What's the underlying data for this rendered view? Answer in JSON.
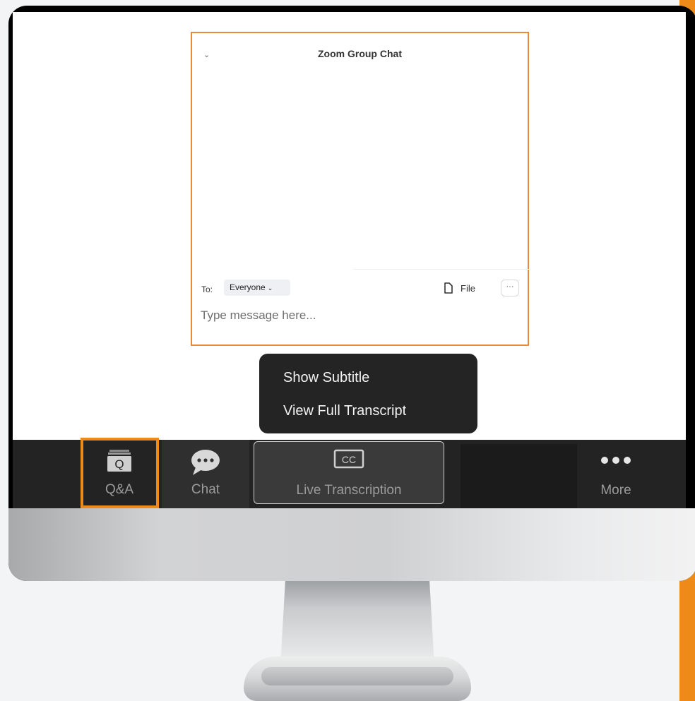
{
  "chat": {
    "title": "Zoom Group Chat",
    "to_label": "To:",
    "recipient": "Everyone",
    "file_label": "File",
    "more_label": "···",
    "message_placeholder": "Type message here..."
  },
  "popup_menu": {
    "items": [
      "Show Subtitle",
      "View Full Transcript"
    ]
  },
  "toolbar": {
    "items": [
      {
        "label": "Q&A",
        "icon": "qa-icon",
        "icon_glyph": "Q"
      },
      {
        "label": "Chat",
        "icon": "chat-bubble-icon"
      },
      {
        "label": "Live Transcription",
        "icon": "cc-icon",
        "icon_glyph": "CC"
      },
      {
        "label": "More",
        "icon": "more-dots-icon"
      }
    ]
  },
  "colors": {
    "highlight": "#ee8a17",
    "toolbar_bg": "#232323",
    "popup_bg": "#242424"
  }
}
